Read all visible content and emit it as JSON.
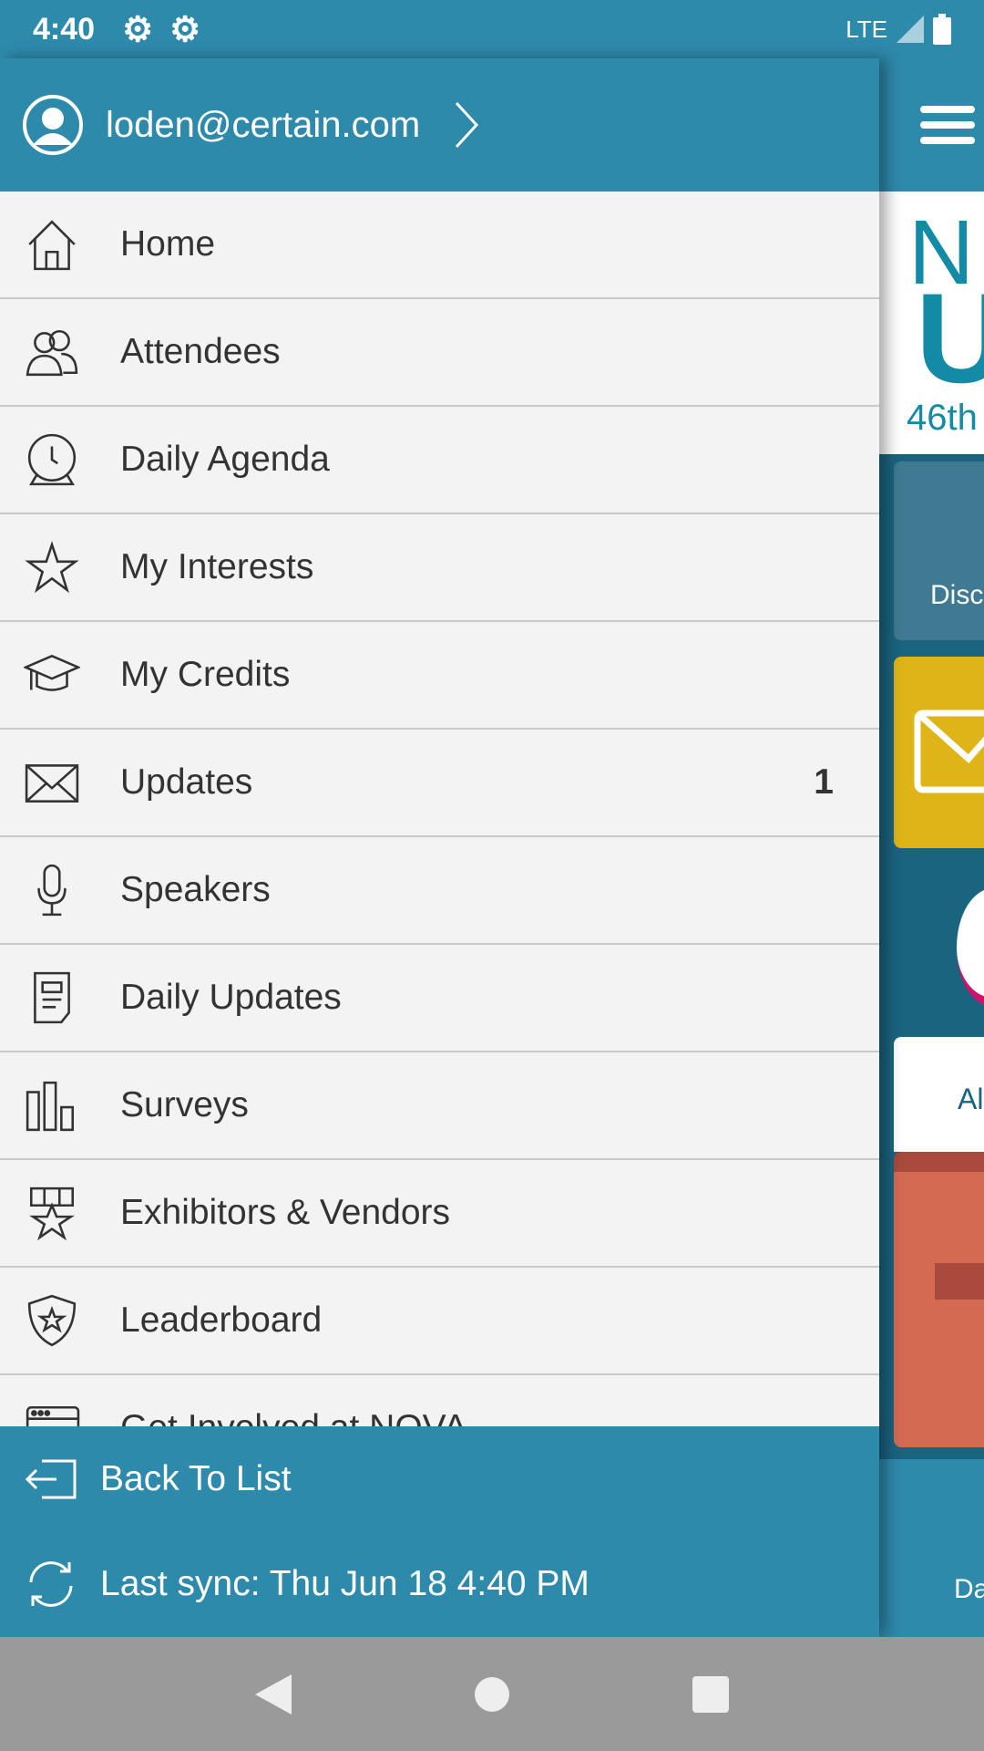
{
  "status_bar": {
    "time": "4:40",
    "network": "LTE"
  },
  "drawer": {
    "user_email": "loden@certain.com",
    "items": [
      {
        "label": "Home",
        "icon": "home-icon"
      },
      {
        "label": "Attendees",
        "icon": "people-icon"
      },
      {
        "label": "Daily Agenda",
        "icon": "clock-icon"
      },
      {
        "label": "My Interests",
        "icon": "star-icon"
      },
      {
        "label": "My Credits",
        "icon": "graduation-cap-icon"
      },
      {
        "label": "Updates",
        "icon": "envelope-icon",
        "badge": "1"
      },
      {
        "label": "Speakers",
        "icon": "microphone-icon"
      },
      {
        "label": "Daily Updates",
        "icon": "document-icon"
      },
      {
        "label": "Surveys",
        "icon": "bar-chart-icon"
      },
      {
        "label": "Exhibitors & Vendors",
        "icon": "exhibitor-star-icon"
      },
      {
        "label": "Leaderboard",
        "icon": "shield-star-icon"
      },
      {
        "label": "Get Involved at NOVA",
        "icon": "browser-window-icon"
      }
    ],
    "back_label": "Back To List",
    "sync_label": "Last sync: Thu Jun 18 4:40 PM"
  },
  "background": {
    "logo_text_1": "N",
    "logo_text_2": "U",
    "logo_sub": "46th",
    "tile_label": "Disc",
    "card_label": "Al",
    "footer_label": "Da"
  },
  "colors": {
    "primary": "#2e8aab",
    "yellow": "#dfb417",
    "coral": "#d56a52"
  }
}
